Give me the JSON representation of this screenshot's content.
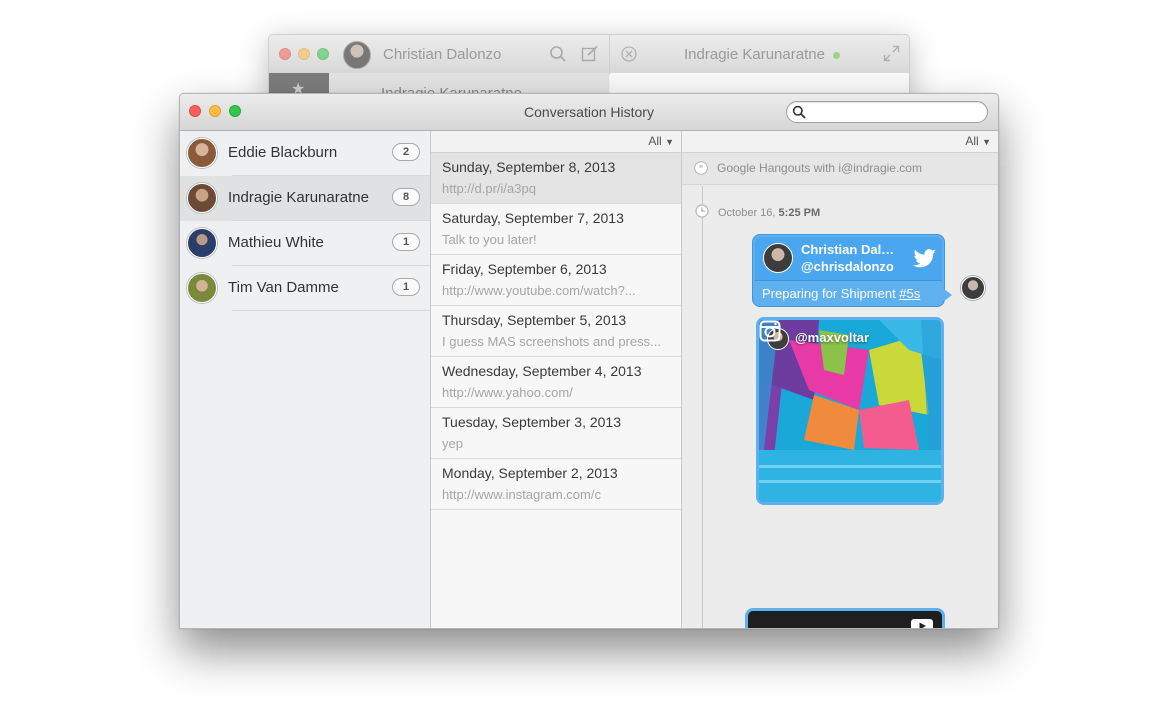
{
  "back_window": {
    "contact_name": "Christian Dalonzo",
    "conversation_name": "Indragie Karunaratne",
    "list_name": "Indragie Karunaratne"
  },
  "window": {
    "title": "Conversation History",
    "search_placeholder": ""
  },
  "contacts": [
    {
      "name": "Eddie Blackburn",
      "count": "2",
      "avatar_color": "#8a5a3c"
    },
    {
      "name": "Indragie Karunaratne",
      "count": "8",
      "avatar_color": "#6b4a36",
      "selected": true
    },
    {
      "name": "Mathieu White",
      "count": "1",
      "avatar_color": "#2b3d6b"
    },
    {
      "name": "Tim Van Damme",
      "count": "1",
      "avatar_color": "#7a8a3a"
    }
  ],
  "dates": {
    "filter": "All",
    "items": [
      {
        "title": "Sunday, September 8, 2013",
        "preview": "http://d.pr/i/a3pq",
        "selected": true
      },
      {
        "title": "Saturday, September 7, 2013",
        "preview": "Talk to you later!"
      },
      {
        "title": "Friday, September 6, 2013",
        "preview": "http://www.youtube.com/watch?..."
      },
      {
        "title": "Thursday, September 5, 2013",
        "preview": "I guess MAS screenshots and press..."
      },
      {
        "title": "Wednesday, September 4, 2013",
        "preview": "http://www.yahoo.com/"
      },
      {
        "title": "Tuesday, September 3, 2013",
        "preview": "yep"
      },
      {
        "title": "Monday, September 2, 2013",
        "preview": "http://www.instagram.com/c"
      }
    ]
  },
  "messages": {
    "filter": "All",
    "service": "Google Hangouts with i@indragie.com",
    "time_date": "October 16,",
    "time_clock": "5:25 PM",
    "tweet": {
      "name": "Christian Dal…",
      "handle": "@chrisdalonzo",
      "text": "Preparing for Shipment ",
      "link": "#5s"
    },
    "instagram": {
      "user": "@maxvoltar"
    }
  },
  "colors": {
    "accent_blue": "#5fb0ef",
    "traffic_red": "#fc605c",
    "traffic_yellow": "#fdbc40",
    "traffic_green": "#34c84a"
  }
}
